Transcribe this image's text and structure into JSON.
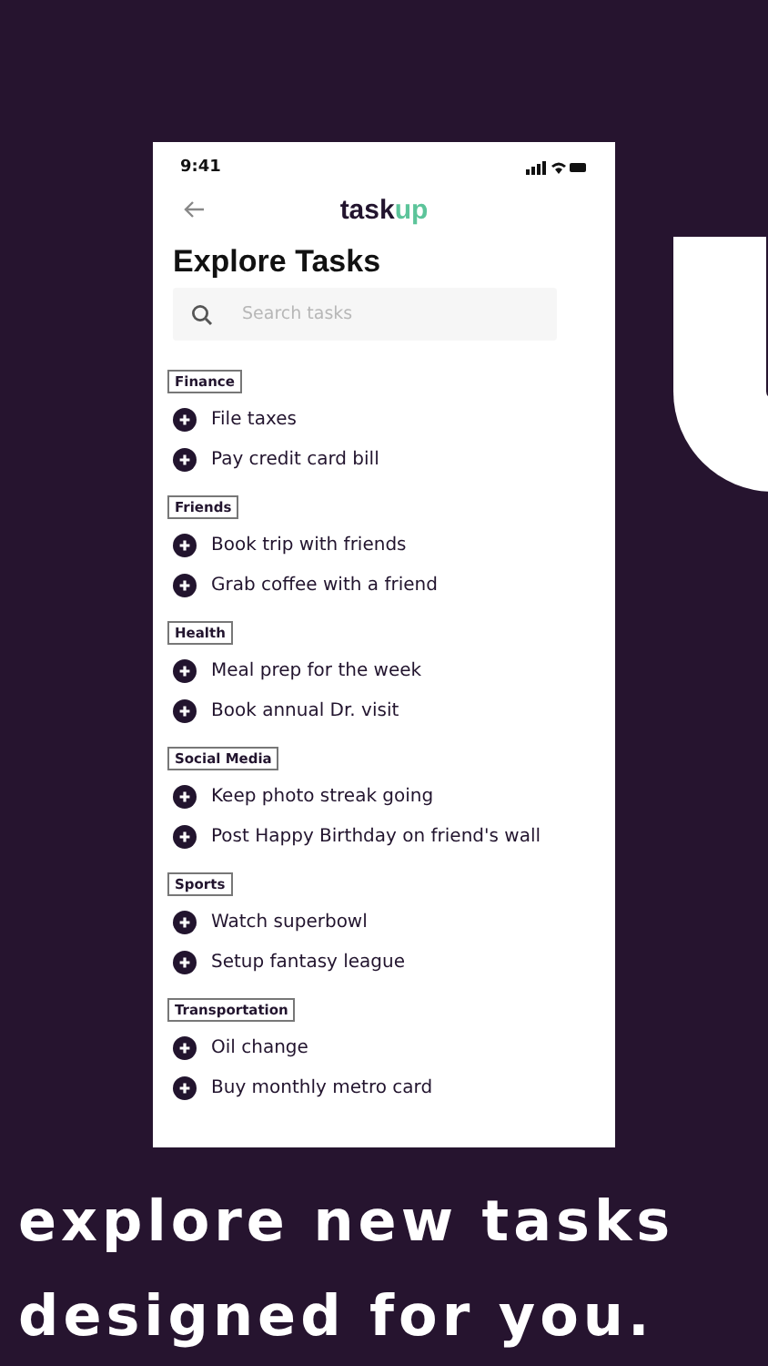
{
  "status_bar": {
    "time": "9:41"
  },
  "header": {
    "logo": {
      "part_1": "task",
      "part_2": "up"
    }
  },
  "title": "Explore Tasks",
  "search": {
    "placeholder": "Search tasks"
  },
  "categories": [
    {
      "name": "Finance",
      "tasks": [
        "File taxes",
        "Pay credit card bill"
      ]
    },
    {
      "name": "Friends",
      "tasks": [
        "Book trip with friends",
        "Grab coffee with a friend"
      ]
    },
    {
      "name": "Health",
      "tasks": [
        "Meal prep for the week",
        "Book annual Dr. visit"
      ]
    },
    {
      "name": "Social Media",
      "tasks": [
        "Keep photo streak going",
        "Post Happy Birthday on friend's wall"
      ]
    },
    {
      "name": "Sports",
      "tasks": [
        "Watch superbowl",
        "Setup fantasy league"
      ]
    },
    {
      "name": "Transportation",
      "tasks": [
        "Oil change",
        "Buy monthly metro card"
      ]
    }
  ],
  "caption": [
    "explore new tasks",
    "designed for you."
  ]
}
